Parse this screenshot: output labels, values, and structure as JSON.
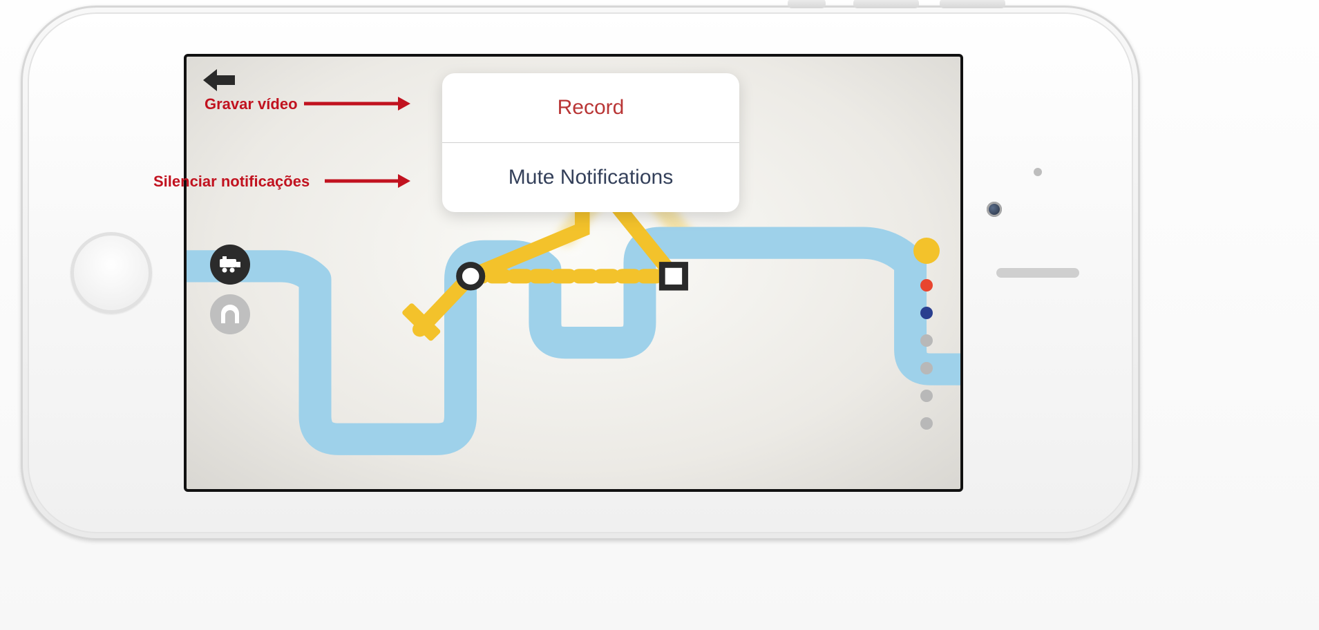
{
  "popup": {
    "record_label": "Record",
    "mute_label": "Mute Notifications"
  },
  "annotations": {
    "record_translation": "Gravar vídeo",
    "mute_translation": "Silenciar notificações"
  },
  "line_colors": {
    "blue_river": "#9ed1ea",
    "yellow_line": "#f3c22b",
    "dot_yellow": "#f3c22b",
    "dot_red": "#e8452f",
    "dot_blue": "#2a3f8f",
    "dot_grey": "#b8b8b8"
  },
  "stations": [
    {
      "shape": "circle"
    },
    {
      "shape": "square"
    }
  ],
  "icons": {
    "back": "back-arrow",
    "train": "train-icon",
    "tunnel": "tunnel-icon"
  }
}
